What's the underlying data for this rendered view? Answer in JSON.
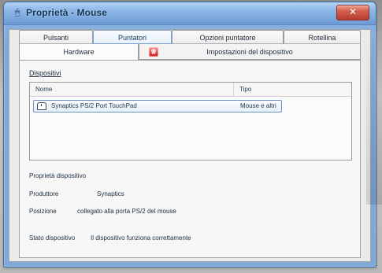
{
  "window": {
    "title": "Proprietà - Mouse"
  },
  "tabs": {
    "row1": [
      "Pulsanti",
      "Puntatori",
      "Opzioni puntatore",
      "Rotellina"
    ],
    "row2": [
      "Hardware",
      "Impostazioni del dispositivo"
    ],
    "selected_top": "Puntatori",
    "active_bottom": "Hardware"
  },
  "section": {
    "devices_label": "Dispositivi",
    "columns": [
      "Nome",
      "Tipo"
    ],
    "devices": [
      {
        "name": "Synaptics PS/2 Port TouchPad",
        "type": "Mouse e altri"
      }
    ]
  },
  "properties": {
    "title": "Proprietà dispositivo",
    "manufacturer_label": "Produttore",
    "manufacturer_value": "Synaptics",
    "location_label": "Posizione",
    "location_value": "collegato alla porta PS/2 del mouse",
    "status_label": "Stato dispositivo",
    "status_value": "Il dispositivo funziona correttamente"
  },
  "icons": {
    "app": "mouse-properties-icon",
    "close": "close-icon",
    "shield": "shield-icon",
    "device": "touchpad-icon"
  }
}
